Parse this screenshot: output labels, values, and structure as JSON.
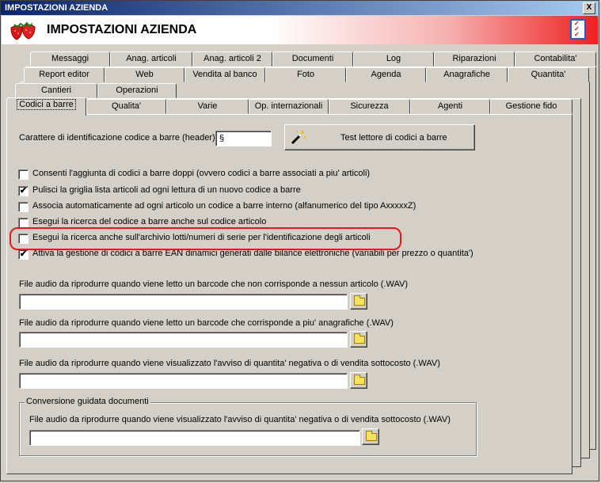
{
  "window": {
    "title": "IMPOSTAZIONI AZIENDA",
    "close_label": "X"
  },
  "header": {
    "title": "IMPOSTAZIONI AZIENDA",
    "logo_icon": "strawberry-icon",
    "right_icon": "checklist-icon"
  },
  "tabs": {
    "row1": [
      "Messaggi",
      "Anag. articoli",
      "Anag. articoli 2",
      "Documenti",
      "Log",
      "Riparazioni",
      "Contabilita'"
    ],
    "row2": [
      "Report editor",
      "Web",
      "Vendita al banco",
      "Foto",
      "Agenda",
      "Anagrafiche",
      "Quantita'"
    ],
    "row3": [
      "Cantieri",
      "Operazioni"
    ],
    "row4": [
      "Codici a barre",
      "Qualita'",
      "Varie",
      "Op. internazionali",
      "Sicurezza",
      "Agenti",
      "Gestione fido"
    ],
    "active": "Codici a barre"
  },
  "barcode": {
    "header_label": "Carattere di identificazione codice a barre (header) :",
    "header_value": "§",
    "test_button": "Test lettore di codici a barre",
    "test_button_icon": "magic-wand-icon"
  },
  "options": [
    {
      "label": "Consenti l'aggiunta di codici a barre doppi (ovvero codici a barre associati a piu' articoli)",
      "checked": false
    },
    {
      "label": "Pulisci la griglia lista articoli ad ogni lettura di un nuovo codice a barre",
      "checked": true
    },
    {
      "label": "Associa automaticamente ad ogni articolo un codice a barre interno (alfanumerico del tipo AxxxxxZ)",
      "checked": false
    },
    {
      "label": "Esegui la ricerca del codice a barre anche sul codice articolo",
      "checked": false
    },
    {
      "label": "Esegui la ricerca anche sull'archivio lotti/numeri di serie per l'identificazione degli articoli",
      "checked": false
    },
    {
      "label": "Attiva la gestione di codici a barre EAN dinamici generati dalle bilance elettroniche (variabili per prezzo o quantita')",
      "checked": true
    }
  ],
  "check_mark": "✔",
  "audio": [
    {
      "label": "File audio da riprodurre quando viene letto un barcode che non corrisponde a nessun articolo (.WAV)",
      "value": ""
    },
    {
      "label": "File audio da riprodurre quando viene letto un barcode che corrisponde a piu' anagrafiche (.WAV)",
      "value": ""
    },
    {
      "label": "File audio da riprodurre quando viene visualizzato l'avviso di quantita' negativa o di vendita sottocosto (.WAV)",
      "value": ""
    }
  ],
  "conversion_group": {
    "title": "Conversione guidata documenti",
    "label": "File audio da riprodurre quando viene visualizzato l'avviso di quantita' negativa o di vendita sottocosto (.WAV)",
    "value": ""
  },
  "colors": {
    "highlight": "#e8161d",
    "title_bar": "#0a246a",
    "header_gradient_end": "#ee2020"
  }
}
